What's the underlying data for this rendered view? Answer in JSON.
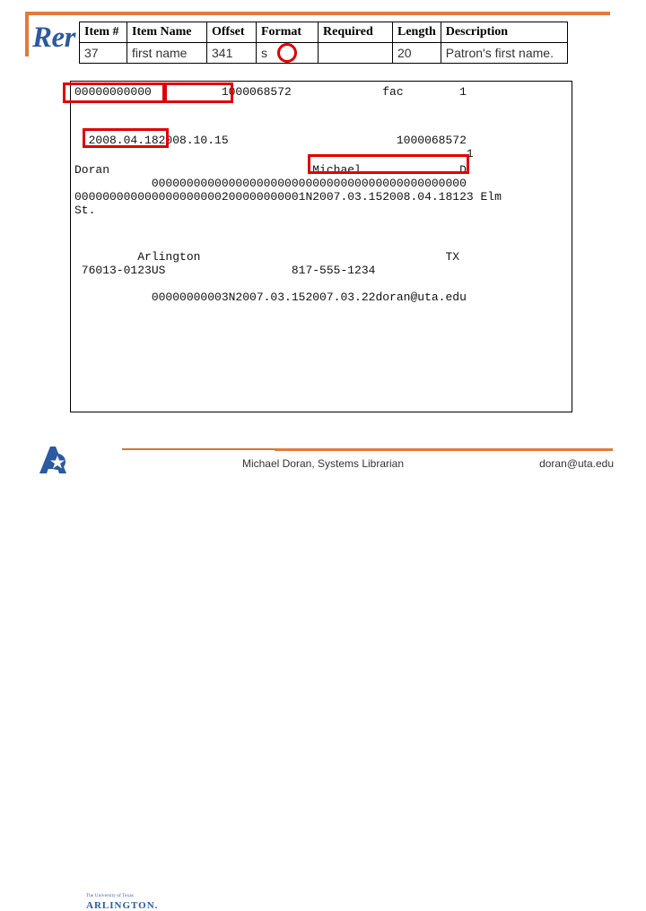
{
  "slide": {
    "title_visible": "Rer",
    "accent_orange": "#E07B39",
    "accent_blue": "#2C5AA0",
    "highlight_red": "#E00000"
  },
  "spec_table": {
    "headers": [
      "Item #",
      "Item Name",
      "Offset",
      "Format",
      "Required",
      "Length",
      "Description"
    ],
    "row": {
      "item_no": "37",
      "item_name": "first name",
      "offset": "341",
      "format": "s",
      "required": "",
      "length": "20",
      "description": "Patron's first name."
    }
  },
  "record_dump": {
    "lines": [
      "00000000000          1000068572             fac        1",
      "",
      "  2008.04.182008.10.15                        1000068572",
      "                                                        1",
      "Doran                             Michael              D",
      "           000000000000000000000000000000000000000000000",
      "000000000000000000000200000000001N2007.03.152008.04.18123 Elm",
      "St.",
      "",
      "         Arlington                                   TX",
      " 76013-0123US                  817-555-1234",
      "",
      "           00000000003N2007.03.152007.03.22doran@uta.edu"
    ]
  },
  "highlights": [
    {
      "name": "patron-id-zeros-highlight",
      "label": "00000000000"
    },
    {
      "name": "blank-field-highlight",
      "label": ""
    },
    {
      "name": "date-highlight",
      "label": "2008.04.18"
    },
    {
      "name": "first-name-highlight",
      "label": "Michael"
    }
  ],
  "footer": {
    "logo_line1": "The University of Texas",
    "logo_line2": "ARLINGTON.",
    "center_text": "Michael Doran, Systems Librarian",
    "email": "doran@uta.edu"
  }
}
